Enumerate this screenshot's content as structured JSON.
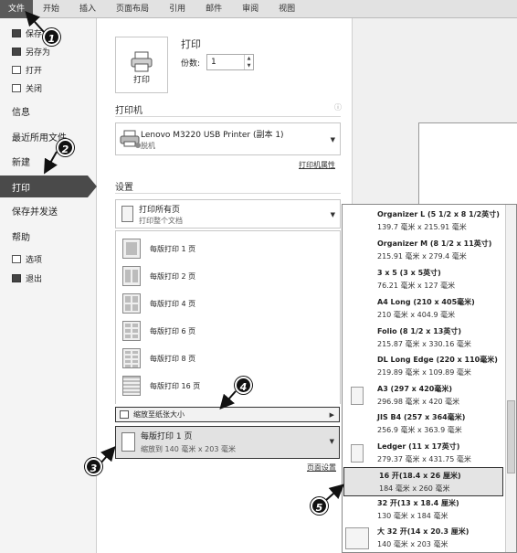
{
  "ribbon_tabs": [
    "文件",
    "开始",
    "插入",
    "页面布局",
    "引用",
    "邮件",
    "审阅",
    "视图"
  ],
  "sidebar": {
    "save": "保存",
    "save_as": "另存为",
    "open": "打开",
    "close": "关闭",
    "info": "信息",
    "recent": "最近所用文件",
    "new": "新建",
    "print": "打印",
    "save_send": "保存并发送",
    "help": "帮助",
    "options": "选项",
    "exit": "退出"
  },
  "print_section": {
    "title": "打印",
    "button_label": "打印",
    "copies_label": "份数:",
    "copies_value": "1"
  },
  "printer_section": {
    "title": "打印机",
    "printer_name": "Lenovo M3220 USB Printer (副本 1)",
    "printer_status": "脱机",
    "properties_link": "打印机属性"
  },
  "settings_section": {
    "title": "设置",
    "print_range_title": "打印所有页",
    "print_range_sub": "打印整个文档",
    "pages_per_sheet": [
      "每版打印 1 页",
      "每版打印 2 页",
      "每版打印 4 页",
      "每版打印 6 页",
      "每版打印 8 页",
      "每版打印 16 页"
    ],
    "scale_to_paper": "缩放至纸张大小",
    "current_title": "每版打印 1 页",
    "current_sub": "缩放到 140 毫米 x 203 毫米",
    "page_setup_link": "页面设置"
  },
  "paper_sizes": [
    {
      "name": "Organizer L (5 1/2 x 8 1/2英寸)",
      "size": "139.7 毫米 x 215.91 毫米"
    },
    {
      "name": "Organizer M (8 1/2 x 11英寸)",
      "size": "215.91 毫米 x 279.4 毫米"
    },
    {
      "name": "3 x 5 (3 x 5英寸)",
      "size": "76.21 毫米 x 127 毫米"
    },
    {
      "name": "A4 Long (210 x 405毫米)",
      "size": "210 毫米 x 404.9 毫米"
    },
    {
      "name": "Folio (8 1/2 x 13英寸)",
      "size": "215.87 毫米 x 330.16 毫米"
    },
    {
      "name": "DL Long Edge (220 x 110毫米)",
      "size": "219.89 毫米 x 109.89 毫米"
    },
    {
      "name": "A3 (297 x 420毫米)",
      "size": "296.98 毫米 x 420 毫米"
    },
    {
      "name": "JIS B4 (257 x 364毫米)",
      "size": "256.9 毫米 x 363.9 毫米"
    },
    {
      "name": "Ledger (11 x 17英寸)",
      "size": "279.37 毫米 x 431.75 毫米"
    },
    {
      "name": "16 开(18.4 x 26 厘米)",
      "size": "184 毫米 x 260 毫米"
    },
    {
      "name": "32 开(13 x 18.4 厘米)",
      "size": "130 毫米 x 184 毫米"
    },
    {
      "name": "大 32 开(14 x 20.3 厘米)",
      "size": "140 毫米 x 203 毫米"
    }
  ],
  "callouts": [
    "1",
    "2",
    "3",
    "4",
    "5"
  ]
}
